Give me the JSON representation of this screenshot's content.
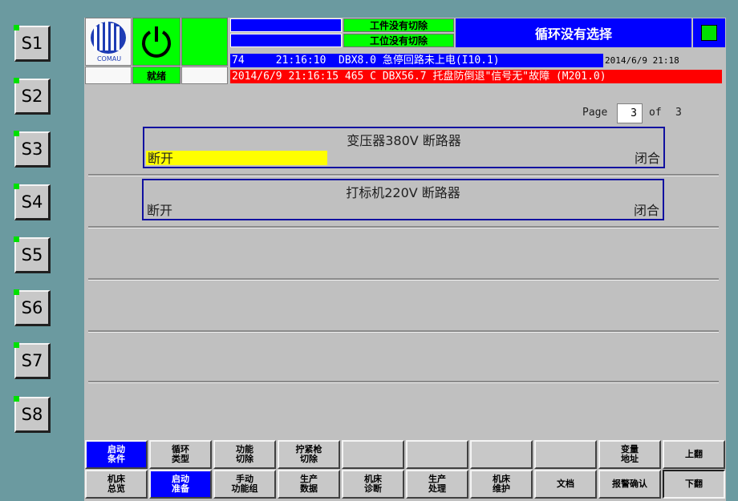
{
  "side_buttons": [
    "S1",
    "S2",
    "S3",
    "S4",
    "S5",
    "S6",
    "S7",
    "S8"
  ],
  "header": {
    "logo_text": "COMAU",
    "status_label": "就绪",
    "cut_off_1": "工件没有切除",
    "cut_off_2": "工位没有切除",
    "cycle_status": "循环没有选择",
    "alarm_line_1": "74     21:16:10  DBX8.0 急停回路未上电(I10.1)",
    "alarm_line_1_time": "2014/6/9 21:18",
    "alarm_line_2": "2014/6/9 21:16:15 465 C DBX56.7 托盘防倒退\"信号无\"故障 (M201.0)"
  },
  "pager": {
    "label": "Page",
    "current": "3",
    "of_label": "of",
    "total": "3"
  },
  "breakers": [
    {
      "title": "变压器380V 断路器",
      "left_label": "断开",
      "right_label": "闭合",
      "level": 0.35
    },
    {
      "title": "打标机220V 断路器",
      "left_label": "断开",
      "right_label": "闭合",
      "level": 0
    }
  ],
  "softkeys_top": [
    "启动\n条件",
    "循环\n类型",
    "功能\n切除",
    "拧紧枪\n切除",
    "",
    "",
    "",
    "",
    "变量\n地址",
    "上翻"
  ],
  "softkeys_bottom": [
    "机床\n总览",
    "启动\n准备",
    "手动\n功能组",
    "生产\n数据",
    "机床\n诊断",
    "生产\n处理",
    "机床\n维护",
    "文档",
    "报警确认",
    "下翻"
  ],
  "colors": {
    "active": "#0000ff",
    "fault": "#ff0000",
    "ok": "#00ff00",
    "level": "#ffff00"
  }
}
